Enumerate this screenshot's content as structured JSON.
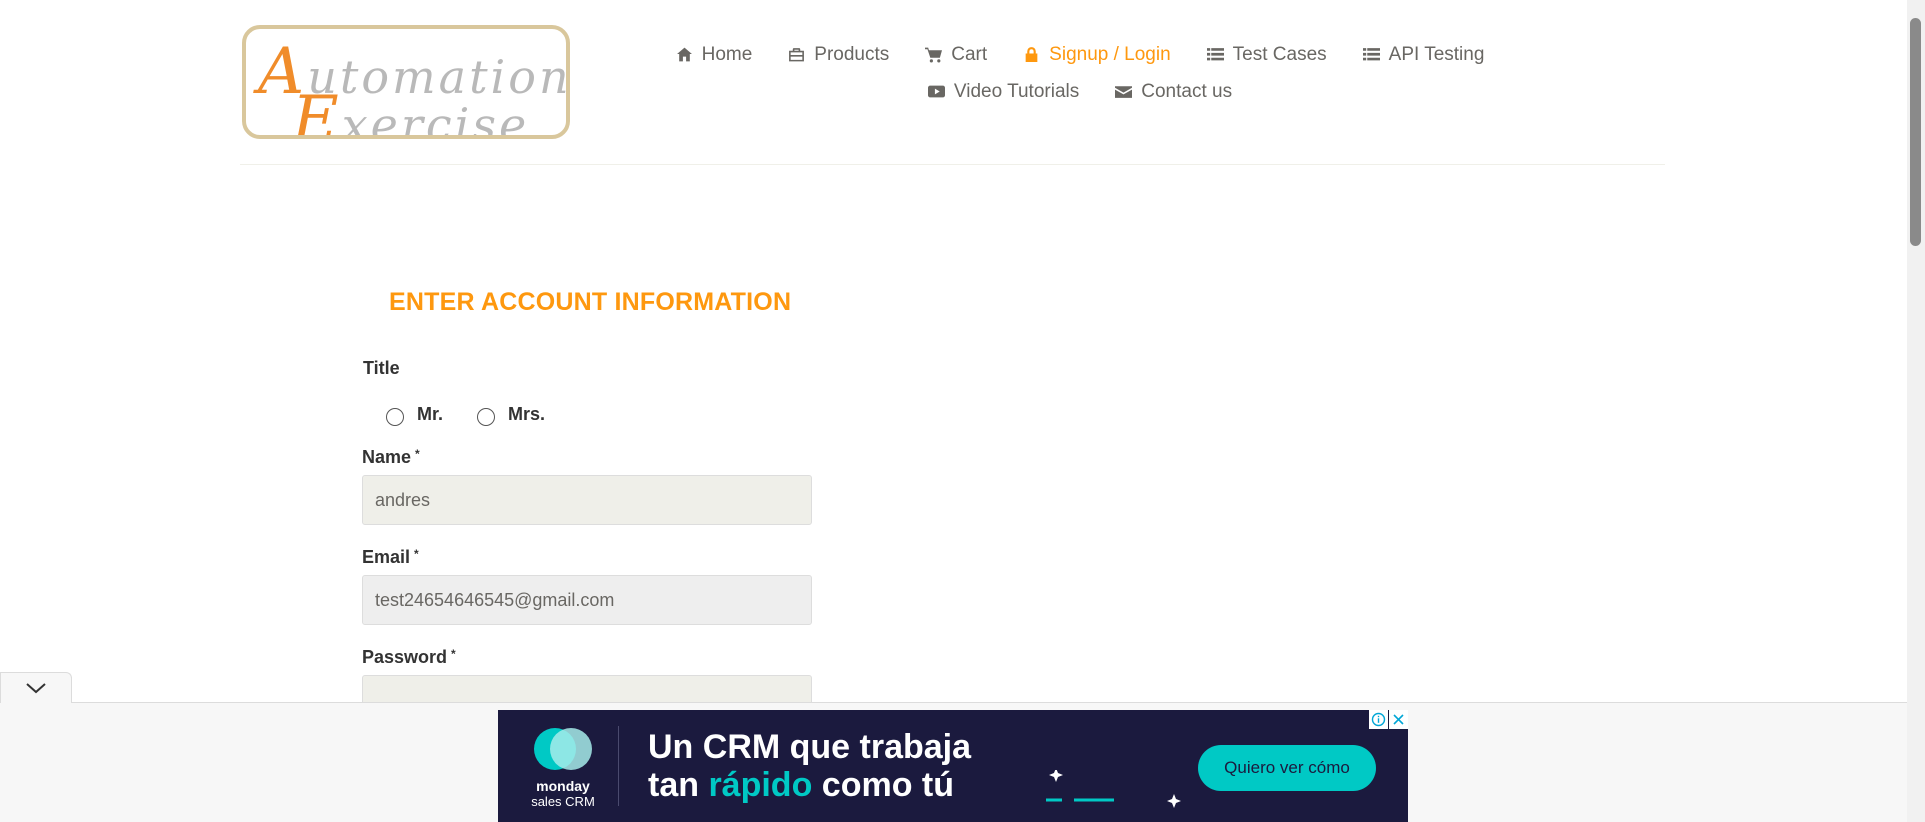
{
  "logo": {
    "line1_cap": "A",
    "line1_rest": "utomation",
    "line2_cap": "E",
    "line2_rest": "xercise"
  },
  "nav": {
    "row1": [
      {
        "label": "Home",
        "icon": "home-icon"
      },
      {
        "label": "Products",
        "icon": "briefcase-icon"
      },
      {
        "label": "Cart",
        "icon": "cart-icon"
      },
      {
        "label": "Signup / Login",
        "icon": "lock-icon",
        "active": true
      },
      {
        "label": "Test Cases",
        "icon": "list-icon"
      },
      {
        "label": "API Testing",
        "icon": "list-icon"
      }
    ],
    "row2": [
      {
        "label": "Video Tutorials",
        "icon": "youtube-icon"
      },
      {
        "label": "Contact us",
        "icon": "envelope-icon"
      }
    ]
  },
  "form": {
    "heading": "Enter Account Information",
    "title_label": "Title",
    "title_options": [
      "Mr.",
      "Mrs."
    ],
    "name_label": "Name",
    "name_value": "andres",
    "email_label": "Email",
    "email_value": "test24654646545@gmail.com",
    "password_label": "Password",
    "password_value": "",
    "required_mark": "*"
  },
  "ad": {
    "brand": "monday",
    "brand_sub": "sales CRM",
    "line1": "Un CRM que trabaja",
    "line2_before": "tan ",
    "line2_accent": "rápido",
    "line2_after": " como tú",
    "cta": "Quiero ver cómo"
  },
  "colors": {
    "accent": "#fe980f",
    "nav_text": "#696763",
    "ad_bg": "#1b1a3e",
    "ad_accent": "#00c9c5"
  }
}
